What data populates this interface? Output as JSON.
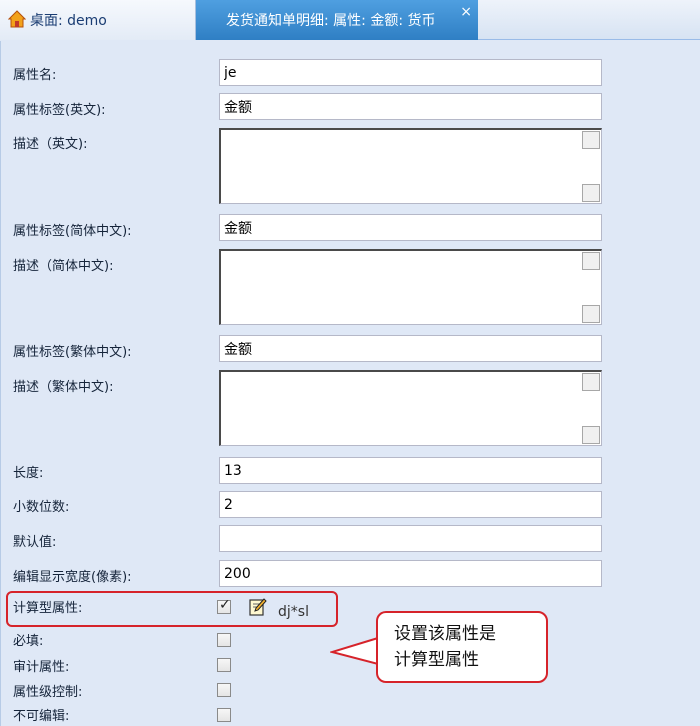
{
  "tabs": {
    "home_label": "桌面: demo",
    "active_label": "发货通知单明细: 属性: 金额: 货币",
    "close_glyph": "×"
  },
  "form": {
    "property_name": {
      "label": "属性名:",
      "value": "je"
    },
    "label_en": {
      "label": "属性标签(英文):",
      "value": "金额"
    },
    "desc_en": {
      "label": "描述（英文):",
      "value": ""
    },
    "label_zh_hans": {
      "label": "属性标签(简体中文):",
      "value": "金额"
    },
    "desc_zh_hans": {
      "label": "描述（简体中文):",
      "value": ""
    },
    "label_zh_hant": {
      "label": "属性标签(繁体中文):",
      "value": "金额"
    },
    "desc_zh_hant": {
      "label": "描述（繁体中文):",
      "value": ""
    },
    "length": {
      "label": "长度:",
      "value": "13"
    },
    "decimals": {
      "label": "小数位数:",
      "value": "2"
    },
    "default_value": {
      "label": "默认值:",
      "value": ""
    },
    "display_width": {
      "label": "编辑显示宽度(像素):",
      "value": "200"
    },
    "computed": {
      "label": "计算型属性:",
      "checked": true,
      "formula": "dj*sl"
    },
    "required": {
      "label": "必填:",
      "checked": false
    },
    "audit": {
      "label": "审计属性:",
      "checked": false
    },
    "attr_control": {
      "label": "属性级控制:",
      "checked": false
    },
    "readonly": {
      "label": "不可编辑:",
      "checked": false
    }
  },
  "annotation": {
    "line1": "设置该属性是",
    "line2": "计算型属性",
    "color": "#d6232a"
  },
  "colors": {
    "panel_bg": "#dfe8f6",
    "active_tab": "#3a8fd2"
  }
}
